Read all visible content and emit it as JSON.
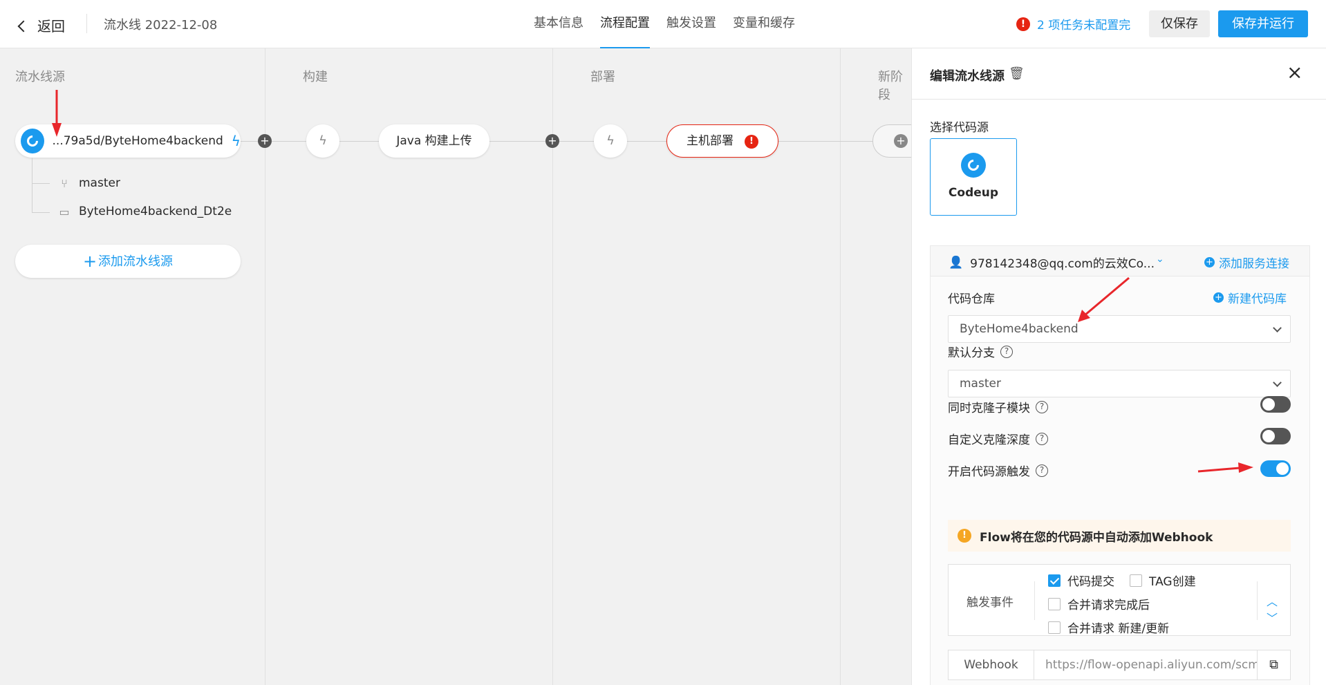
{
  "header": {
    "back_label": "返回",
    "pipeline_title": "流水线 2022-12-08",
    "tabs": [
      {
        "label": "基本信息",
        "active": false
      },
      {
        "label": "流程配置",
        "active": true
      },
      {
        "label": "触发设置",
        "active": false
      },
      {
        "label": "变量和缓存",
        "active": false
      }
    ],
    "warning_text": "2 项任务未配置完",
    "warning_icon": "!",
    "save_label": "仅保存",
    "save_run_label": "保存并运行"
  },
  "canvas": {
    "stages": [
      {
        "title": "流水线源"
      },
      {
        "title": "构建"
      },
      {
        "title": "部署"
      },
      {
        "title": "新阶段"
      }
    ],
    "source": {
      "name": "...79a5d/ByteHome4backend",
      "branch": "master",
      "dir": "ByteHome4backend_Dt2e",
      "add_label": "添加流水线源",
      "add_plus": "+"
    },
    "plus_glyph": "+",
    "trigger_glyph": "ϟ",
    "jobs": {
      "build": "Java 构建上传",
      "deploy": "主机部署",
      "deploy_error_icon": "!"
    }
  },
  "panel": {
    "title": "编辑流水线源",
    "trash_icon": "🗑",
    "close_icon": "×",
    "select_source_label": "选择代码源",
    "source_option": "Codeup",
    "service_user": "978142348@qq.com的云效Co...",
    "add_service_label": "添加服务连接",
    "repo_label": "代码仓库",
    "new_repo_label": "新建代码库",
    "repo_value": "ByteHome4backend",
    "branch_label": "默认分支",
    "branch_value": "master",
    "help_glyph": "?",
    "options": [
      {
        "label": "同时克隆子模块",
        "on": false
      },
      {
        "label": "自定义克隆深度",
        "on": false
      },
      {
        "label": "开启代码源触发",
        "on": true
      }
    ],
    "notice_icon": "!",
    "notice_text": "Flow将在您的代码源中自动添加Webhook",
    "events_label": "触发事件",
    "events": [
      {
        "label": "代码提交",
        "checked": true
      },
      {
        "label": "TAG创建",
        "checked": false
      },
      {
        "label": "合并请求完成后",
        "checked": false
      },
      {
        "label": "合并请求 新建/更新",
        "checked": false
      }
    ],
    "webhook_label": "Webhook",
    "webhook_url": "https://flow-openapi.aliyun.com/scm/",
    "copy_icon": "⧉"
  },
  "colors": {
    "accent": "#1b9aee",
    "error": "#e62412",
    "warning": "#f5a623",
    "annotation_arrow": "#e8262b"
  }
}
